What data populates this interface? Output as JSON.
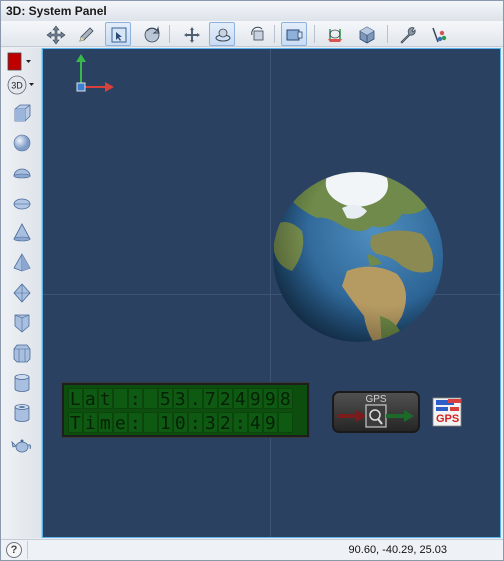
{
  "window": {
    "title": "3D: System Panel",
    "subtitle": "3D"
  },
  "toolbar": {
    "buttons": [
      {
        "icon": "move-arrows-icon",
        "active": false
      },
      {
        "icon": "pencil-icon",
        "active": false
      },
      {
        "icon": "select-region-icon",
        "active": true
      },
      {
        "icon": "rotate-icon",
        "active": false
      },
      {
        "icon": "pan-icon",
        "active": false
      },
      {
        "icon": "orbit-icon",
        "active": true
      },
      {
        "icon": "rotate-camera-icon",
        "active": false
      },
      {
        "icon": "view-2d-icon",
        "active": true
      },
      {
        "icon": "ground-plane-icon",
        "active": false
      },
      {
        "icon": "cube-view-icon",
        "active": false
      },
      {
        "icon": "wrench-icon",
        "active": false
      },
      {
        "icon": "paint-tools-icon",
        "active": false
      }
    ]
  },
  "sidebar": {
    "color_swatch": "#c00000",
    "mode_label": "3D",
    "shapes": [
      "cube-icon",
      "sphere-icon",
      "hemisphere-icon",
      "ellipsoid-icon",
      "cone-icon",
      "pyramid-icon",
      "octahedron-icon",
      "prism-icon",
      "hex-prism-icon",
      "cylinder-icon",
      "tube-icon",
      "teapot-icon"
    ]
  },
  "lcd": {
    "line1": "Lat : 53.724998",
    "line2": "Time: 10:32:49 "
  },
  "gps_block": {
    "label": "GPS"
  },
  "gps_icon_label": "GPS",
  "status": {
    "help": "?",
    "coordinates": "90.60, -40.29, 25.03"
  },
  "colors": {
    "viewport_bg": "#2b4162",
    "lcd_bg": "#0d4d0d",
    "accent_border": "#5ab2ea"
  }
}
